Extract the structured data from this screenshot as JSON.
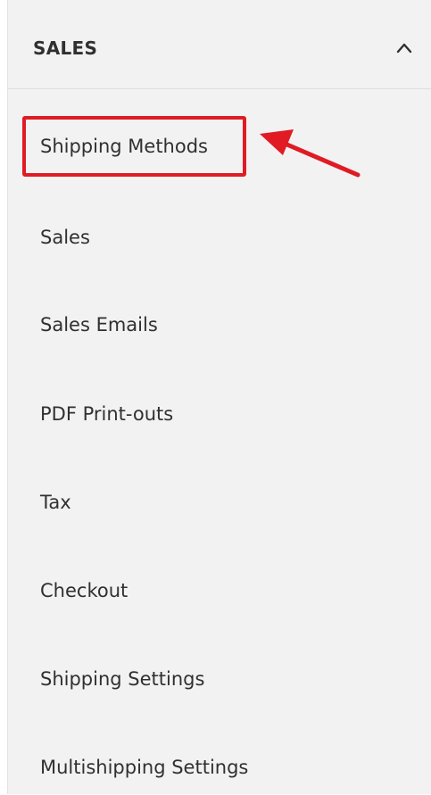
{
  "section": {
    "title": "SALES",
    "expanded": true,
    "toggle_icon": "chevron-up-icon"
  },
  "items": [
    {
      "label": "Shipping Methods",
      "highlighted": true
    },
    {
      "label": "Sales"
    },
    {
      "label": "Sales Emails"
    },
    {
      "label": "PDF Print-outs"
    },
    {
      "label": "Tax"
    },
    {
      "label": "Checkout"
    },
    {
      "label": "Shipping Settings"
    },
    {
      "label": "Multishipping Settings"
    }
  ],
  "annotation": {
    "highlight_color": "#e01b24",
    "arrow_icon": "arrow-left-icon"
  },
  "colors": {
    "panel_background": "#f2f2f2",
    "text": "#303030"
  }
}
